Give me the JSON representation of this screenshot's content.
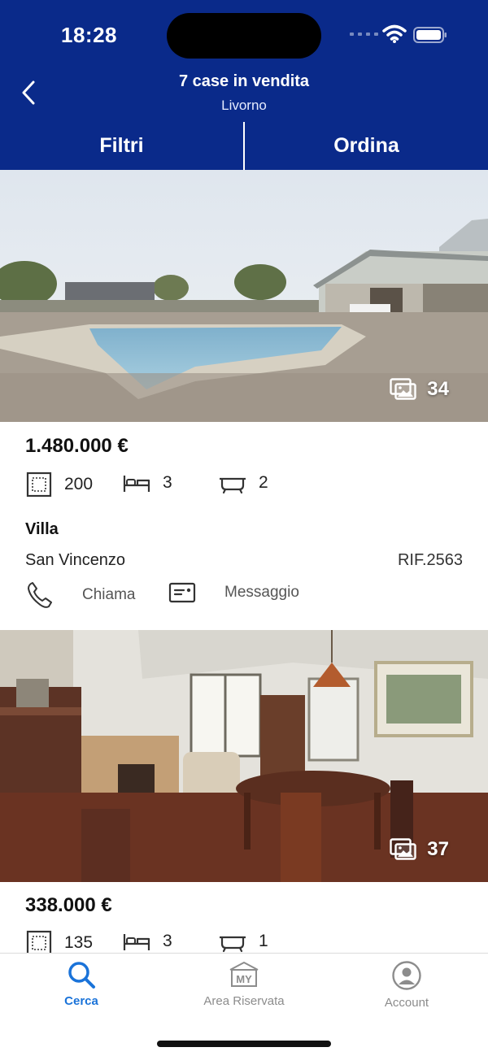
{
  "status_bar": {
    "time": "18:28"
  },
  "header": {
    "title": "7 case in vendita",
    "subtitle": "Livorno",
    "filters_label": "Filtri",
    "sort_label": "Ordina"
  },
  "listings": [
    {
      "photo_count": "34",
      "price": "1.480.000 €",
      "area": "200",
      "bedrooms": "3",
      "bathrooms": "2",
      "type": "Villa",
      "location": "San Vincenzo",
      "reference": "RIF.2563",
      "call_label": "Chiama",
      "message_label": "Messaggio"
    },
    {
      "photo_count": "37",
      "price": "338.000 €",
      "area": "135",
      "bedrooms": "3",
      "bathrooms": "1"
    }
  ],
  "tabbar": {
    "items": [
      {
        "label": "Cerca",
        "icon": "search-icon",
        "active": true
      },
      {
        "label": "Area Riservata",
        "icon": "my-area-icon",
        "active": false
      },
      {
        "label": "Account",
        "icon": "account-icon",
        "active": false
      }
    ],
    "my_badge": "MY"
  },
  "colors": {
    "header_bg": "#0a2a8a",
    "active_tab": "#1a73d9",
    "inactive_tab": "#8c8c8c"
  }
}
